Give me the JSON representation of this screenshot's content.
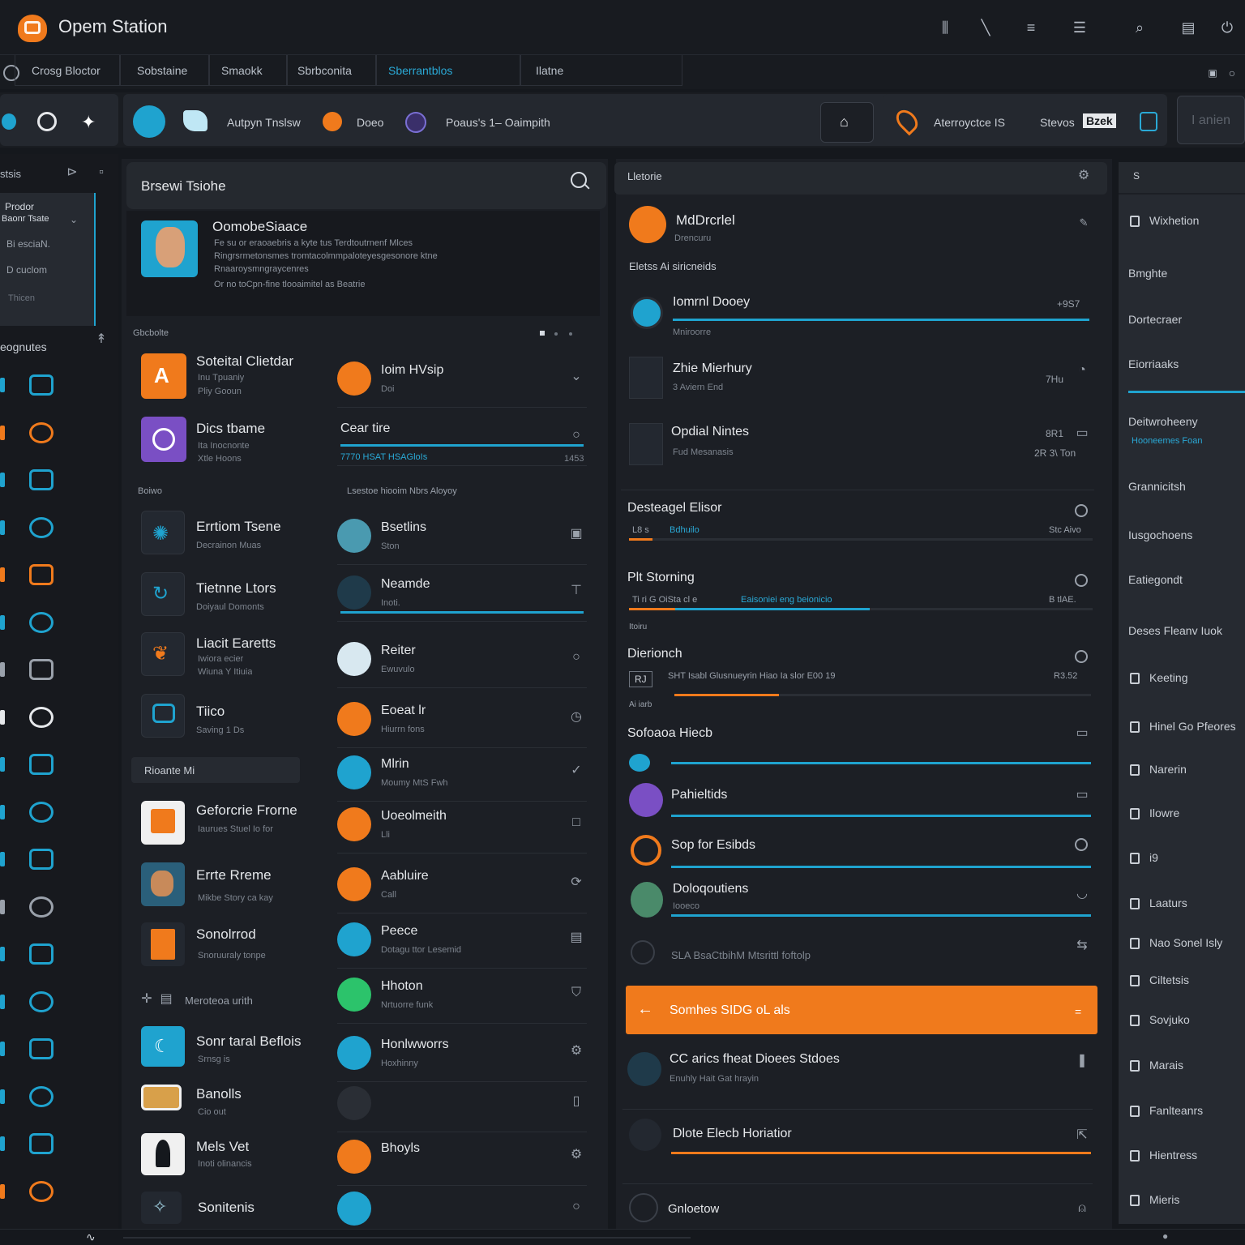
{
  "app": {
    "title": "Opem Station"
  },
  "topbar_icons": [
    "columns-icon",
    "edit-icon",
    "menu-icon",
    "list-icon",
    "search-icon",
    "stack-icon",
    "power-icon"
  ],
  "tabs": [
    {
      "label": "Crosg Bloctor"
    },
    {
      "label": "Sobstaine"
    },
    {
      "label": "Smaokk"
    },
    {
      "label": "Sbrbconita"
    },
    {
      "label": "Sberrantblos"
    },
    {
      "label": "Ilatne"
    }
  ],
  "toolbar": {
    "group1_label": "Autpyn Tnslsw",
    "group2_label": "Doeo",
    "group3_label": "Poaus's 1– Oaimpith",
    "group4_label": "Aterroyctce IS",
    "group4_b": "Stevos",
    "group4_badge": "Bzek",
    "search_placeholder": "I anien"
  },
  "sidebar": {
    "header": "stsis",
    "nav": [
      {
        "label": "Prodor"
      },
      {
        "label": "Baonr Tsate"
      },
      {
        "label": "Bi esciaN."
      },
      {
        "label": "D cuclom"
      },
      {
        "label": "Thicen"
      }
    ],
    "section": "eognutes",
    "icons": [
      "cube-icon",
      "palette-icon",
      "blocks-icon",
      "chart-icon",
      "share-icon",
      "globe-icon",
      "monitor-icon",
      "camera-icon",
      "grid-icon",
      "disc-icon",
      "image-icon",
      "layers-icon",
      "network-icon",
      "map-icon",
      "bird-icon",
      "target-icon",
      "fish-icon",
      "edit-icon"
    ]
  },
  "middle": {
    "search_title": "Brsewi Tsiohe",
    "profile": {
      "name": "OomobeSiaace",
      "desc1": "Fe su or eraoaebris a kyte tus Terdtoutrnenf Mlces",
      "desc2": "Ringrsrmetonsmes tromtacolmmpaloteyesgesonore ktne",
      "desc3": "Rnaaroysmngraycenres",
      "desc4": "Or no toCpn-fine tlooaimitel as Beatrie"
    },
    "section1": "Gbcbolte",
    "section2": "Boiwo",
    "section2_right": "Lsestoe hiooim Nbrs Aloyoy",
    "left_items": [
      {
        "title": "Soteital Clietdar",
        "sub1": "Inu Tpuaniy",
        "sub2": "Pliy Gooun",
        "color": "#f07a1c"
      },
      {
        "title": "Dics tbame",
        "sub1": "Ita Inocnonte",
        "sub2": "Xtle Hoons",
        "color": "#7a4fc4"
      },
      {
        "title": "Errtiom Tsene",
        "sub1": "Decrainon Muas",
        "sub2": "",
        "color": "#1f2a33"
      },
      {
        "title": "Tietnne Ltors",
        "sub1": "Doiyaul Domonts",
        "sub2": "",
        "color": "#1f2a33"
      },
      {
        "title": "Liacit Earetts",
        "sub1": "Iwiora ecier",
        "sub2": "Wiuna Y Itiuia",
        "color": "#1f2a33"
      },
      {
        "title": "Tiico",
        "sub1": "Saving 1 Ds",
        "sub2": "",
        "color": "#1f2a33"
      }
    ],
    "chip": "Rioante Mi",
    "left_items2": [
      {
        "title": "Geforcrie Frorne",
        "sub1": "Iaurues Stuel Io for",
        "color": "#f0f0f0"
      },
      {
        "title": "Errte Rreme",
        "sub1": "Mikbe Story ca kay",
        "color": "#2a5f7a"
      },
      {
        "title": "Sonolrrod",
        "sub1": "Snoruuraly tonpe",
        "color": "#f07a1c"
      }
    ],
    "section3": "Meroteoa urith",
    "left_items3": [
      {
        "title": "Sonr taral Beflois",
        "sub1": "Srnsg is",
        "color": "#1fa3cf"
      },
      {
        "title": "Banolls",
        "sub1": "Cio out",
        "color": "#d8a04a"
      },
      {
        "title": "Mels Vet",
        "sub1": "Inoti olinancis",
        "color": "#f0f0f0"
      },
      {
        "title": "Sonitenis",
        "sub1": "",
        "color": "#1f2a33"
      }
    ],
    "right_items": [
      {
        "title": "Ioim HVsip",
        "sub": "Doi",
        "icon": "chevron-down-icon"
      },
      {
        "title": "Cear tire",
        "sub": "7770  HSAT HSAGloIs",
        "icon": "circle-icon",
        "extra": "1453"
      },
      {
        "title": "Bsetlins",
        "sub": "Ston",
        "icon": "box-icon"
      },
      {
        "title": "Neamde",
        "sub": "Inoti.",
        "icon": "pin-icon"
      },
      {
        "title": "Reiter",
        "sub": "Ewuvulo",
        "icon": "circle-icon"
      },
      {
        "title": "Eoeat lr",
        "sub": "Hiurrn fons",
        "icon": "clock-icon"
      },
      {
        "title": "Mlrin",
        "sub": "Moumy  MtS  Fwh",
        "icon": "check-icon"
      },
      {
        "title": "Uoeolmeith",
        "sub": "Lli",
        "icon": "square-icon"
      },
      {
        "title": "Aabluire",
        "sub": "Call",
        "icon": "refresh-icon"
      },
      {
        "title": "Peece",
        "sub": "Dotagu ttor Lesemid",
        "icon": "doc-icon"
      },
      {
        "title": "Hhoton",
        "sub": "Nrtuorre funk",
        "icon": "shield-icon"
      },
      {
        "title": "Honlwworrs",
        "sub": "Hoxhinny",
        "icon": "settings-icon"
      },
      {
        "title": "",
        "sub": "",
        "icon": "note-icon"
      },
      {
        "title": "Bhoyls",
        "sub": "",
        "icon": "gear-icon"
      },
      {
        "title": "",
        "sub": "",
        "icon": "circle-icon"
      }
    ]
  },
  "right": {
    "header": "Lletorie",
    "model": {
      "title": "MdDrcrlel",
      "sub": "Drencuru"
    },
    "section1": "Eletss Ai siricneids",
    "rows": [
      {
        "title": "Iomrnl Dooey",
        "sub": "Mniroorre",
        "value": "+9S7",
        "accent": "#1fa3cf"
      },
      {
        "title": "Zhie Mierhury",
        "sub": "3 Aviern End",
        "value": "7Hu",
        "accent": "#2a2e35"
      },
      {
        "title": "Opdial Nintes",
        "sub": "Fud Mesanasis",
        "value": "8R1",
        "value2": "2R 3\\ Ton",
        "accent": "#2a2e35"
      }
    ],
    "progress_sections": [
      {
        "title": "Desteagel Elisor",
        "left": "L8 s",
        "link": "Bdhuilo",
        "right": "Stc Aivo",
        "fill": 0.05,
        "accent": "#f07a1c"
      },
      {
        "title": "Plt Storning",
        "left": "Ti ri G OiSta cl e",
        "link": "Eaisoniei eng beionicio",
        "right": "B tlAE.",
        "tag": "Itoiru",
        "fill": 0.52,
        "accent": "#f07a1c"
      },
      {
        "title": "Dierionch",
        "left": "SHT Isabl Glusnueyrin Hiao Ia slor E00 19",
        "right": "R3.52",
        "tag": "Ai iarb",
        "badge": "RJ",
        "fill": 0.25,
        "accent": "#f07a1c"
      }
    ],
    "section2": "Sofoaoa Hiecb",
    "list": [
      {
        "title": "Pahieltids",
        "color": "#7a4fc4",
        "icon": "chat-icon"
      },
      {
        "title": "Sop for Esibds",
        "color": "#f07a1c",
        "icon": "circle-icon"
      },
      {
        "title": "Doloqoutiens",
        "sub": "Iooeco",
        "color": "#1fa3cf",
        "icon": "spinner-icon"
      }
    ],
    "note": "SLA BsaCtbihM Mtsrittl foftolp",
    "orange_row": "Somhes SIDG oL als",
    "bottom1": {
      "title": "CC arics fheat Dioees Stdoes",
      "sub": "Enuhly Hait Gat hrayin"
    },
    "bottom2": {
      "title": "Dlote Elecb Horiatior"
    },
    "bottom3": {
      "title": "Gnloetow"
    }
  },
  "rightside": {
    "header": "S",
    "items": [
      "Wixhetion",
      "Bmghte",
      "Dortecraer",
      "Eiorriaaks",
      "Deitwroheeny",
      "Grannicitsh",
      "Iusgochoens",
      "Eatiegondt",
      "Deses Fleanv Iuok",
      "Keeting",
      "Hinel Go Pfeores",
      "Narerin",
      "Ilowre",
      "i9",
      "Laaturs",
      "Nao Sonel Isly",
      "Ciltetsis",
      "Sovjuko",
      "Marais",
      "Fanlteanrs",
      "Hientress",
      "Mieris"
    ],
    "sub": "Hooneemes  Foan"
  },
  "colors": {
    "accent": "#1fa3cf",
    "orange": "#f07a1c",
    "bg": "#15181d",
    "panel": "#1c1f25"
  }
}
